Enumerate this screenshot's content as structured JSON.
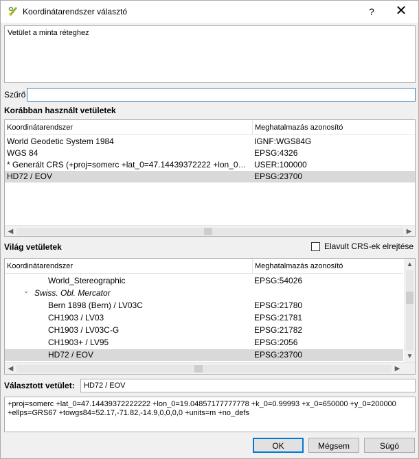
{
  "window": {
    "title": "Koordinátarendszer választó",
    "help_glyph": "?",
    "close_glyph": "✕"
  },
  "description": "Vetület a minta réteghez",
  "filter": {
    "label": "Szűrő",
    "value": ""
  },
  "recent": {
    "title": "Korábban használt vetületek",
    "headers": [
      "Koordinátarendszer",
      "Meghatalmazás azonosító"
    ],
    "rows": [
      {
        "name": "World Geodetic System 1984",
        "auth": "IGNF:WGS84G"
      },
      {
        "name": "WGS 84",
        "auth": "EPSG:4326"
      },
      {
        "name": " * Generált CRS (+proj=somerc +lat_0=47.14439372222 +lon_0=1...",
        "auth": "USER:100000"
      },
      {
        "name": "HD72 / EOV",
        "auth": "EPSG:23700"
      }
    ],
    "selected_index": 3
  },
  "world": {
    "title": "Világ vetületek",
    "hide_deprecated_label": "Elavult CRS-ek elrejtése",
    "hide_deprecated_checked": false,
    "headers": [
      "Koordinátarendszer",
      "Meghatalmazás azonosító"
    ],
    "rows": [
      {
        "name": "World_Stereographic",
        "auth": "EPSG:54026",
        "level": 2
      },
      {
        "name": "Swiss. Obl. Mercator",
        "auth": "",
        "level": 1,
        "expanded": true
      },
      {
        "name": "Bern 1898 (Bern) / LV03C",
        "auth": "EPSG:21780",
        "level": 2
      },
      {
        "name": "CH1903 / LV03",
        "auth": "EPSG:21781",
        "level": 2
      },
      {
        "name": "CH1903 / LV03C-G",
        "auth": "EPSG:21782",
        "level": 2
      },
      {
        "name": "CH1903+ / LV95",
        "auth": "EPSG:2056",
        "level": 2
      },
      {
        "name": "HD72 / EOV",
        "auth": "EPSG:23700",
        "level": 2
      }
    ],
    "selected_index": 6
  },
  "selected": {
    "label": "Választott vetület:",
    "value": "HD72 / EOV"
  },
  "proj_string": "+proj=somerc +lat_0=47.14439372222222 +lon_0=19.04857177777778 +k_0=0.99993 +x_0=650000 +y_0=200000 +ellps=GRS67 +towgs84=52.17,-71.82,-14.9,0,0,0,0 +units=m +no_defs",
  "buttons": {
    "ok": "OK",
    "cancel": "Mégsem",
    "help": "Súgó"
  }
}
